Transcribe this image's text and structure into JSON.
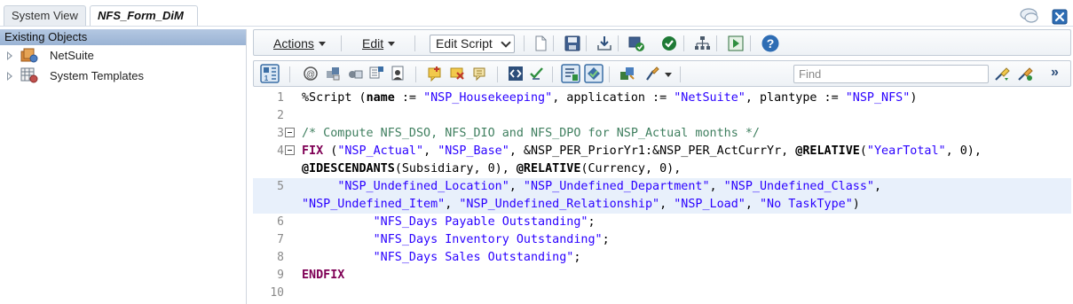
{
  "tabs": [
    {
      "label": "System View"
    },
    {
      "label": "NFS_Form_DiM"
    }
  ],
  "left_panel": {
    "header": "Existing Objects",
    "items": [
      {
        "label": "NetSuite",
        "icon": "netsuite-app-icon"
      },
      {
        "label": "System Templates",
        "icon": "templates-grid-icon"
      }
    ]
  },
  "toolbar": {
    "actions_label": "Actions",
    "edit_label": "Edit",
    "mode_select_value": "Edit Script",
    "icons": [
      "new-document-icon",
      "save-icon",
      "download-icon",
      "validate-icon",
      "check-icon",
      "hierarchy-icon",
      "run-icon",
      "help-icon"
    ]
  },
  "toolbar2": {
    "find_placeholder": "Find",
    "icons": [
      "member-selector-icon",
      "function-icon",
      "dimension-icon",
      "variable-icon",
      "smartlist-icon",
      "template-icon",
      "insert-comment-icon",
      "remove-comment-icon",
      "comment-icon",
      "code-block-icon",
      "reformat-icon",
      "outline-icon",
      "syntax-icon",
      "members-icon",
      "brush-icon",
      "find-next-icon",
      "replace-icon",
      "more-icon"
    ]
  },
  "editor": {
    "lines": [
      {
        "n": "1",
        "html": "%Script (<span class=\"kw2\">name</span> := <span class=\"str\">\"NSP_Housekeeping\"</span>, application := <span class=\"str\">\"NetSuite\"</span>, plantype := <span class=\"str\">\"NSP_NFS\"</span>)"
      },
      {
        "n": "2",
        "html": ""
      },
      {
        "n": "3",
        "fold": true,
        "html": "<span class=\"cmt\">/* Compute NFS_DSO, NFS_DIO and NFS_DPO for NSP_Actual months */</span>"
      },
      {
        "n": "4",
        "fold": true,
        "html": "<span class=\"kw\">FIX</span> (<span class=\"str\">\"NSP_Actual\"</span>, <span class=\"str\">\"NSP_Base\"</span>, &amp;NSP_PER_PriorYr1:&amp;NSP_PER_ActCurrYr, <span class=\"kw2\">@RELATIVE</span>(<span class=\"str\">\"YearTotal\"</span>, 0),"
      },
      {
        "n": "",
        "html": "<span class=\"kw2\">@IDESCENDANTS</span>(Subsidiary, 0), <span class=\"kw2\">@RELATIVE</span>(Currency, 0),"
      },
      {
        "n": "5",
        "hl": true,
        "html": "     <span class=\"str\">\"NSP_Undefined_Location\"</span>, <span class=\"str\">\"NSP_Undefined_Department\"</span>, <span class=\"str\">\"NSP_Undefined_Class\"</span>,"
      },
      {
        "n": "",
        "hl": true,
        "html": "<span class=\"str\">\"NSP_Undefined_Item\"</span>, <span class=\"str\">\"NSP_Undefined_Relationship\"</span>, <span class=\"str\">\"NSP_Load\"</span>, <span class=\"str\">\"No TaskType\"</span>)"
      },
      {
        "n": "6",
        "html": "          <span class=\"str\">\"NFS_Days Payable Outstanding\"</span>;"
      },
      {
        "n": "7",
        "html": "          <span class=\"str\">\"NFS_Days Inventory Outstanding\"</span>;"
      },
      {
        "n": "8",
        "html": "          <span class=\"str\">\"NFS_Days Sales Outstanding\"</span>;"
      },
      {
        "n": "9",
        "html": "<span class=\"kw\">ENDFIX</span>"
      },
      {
        "n": "10",
        "html": ""
      }
    ]
  }
}
